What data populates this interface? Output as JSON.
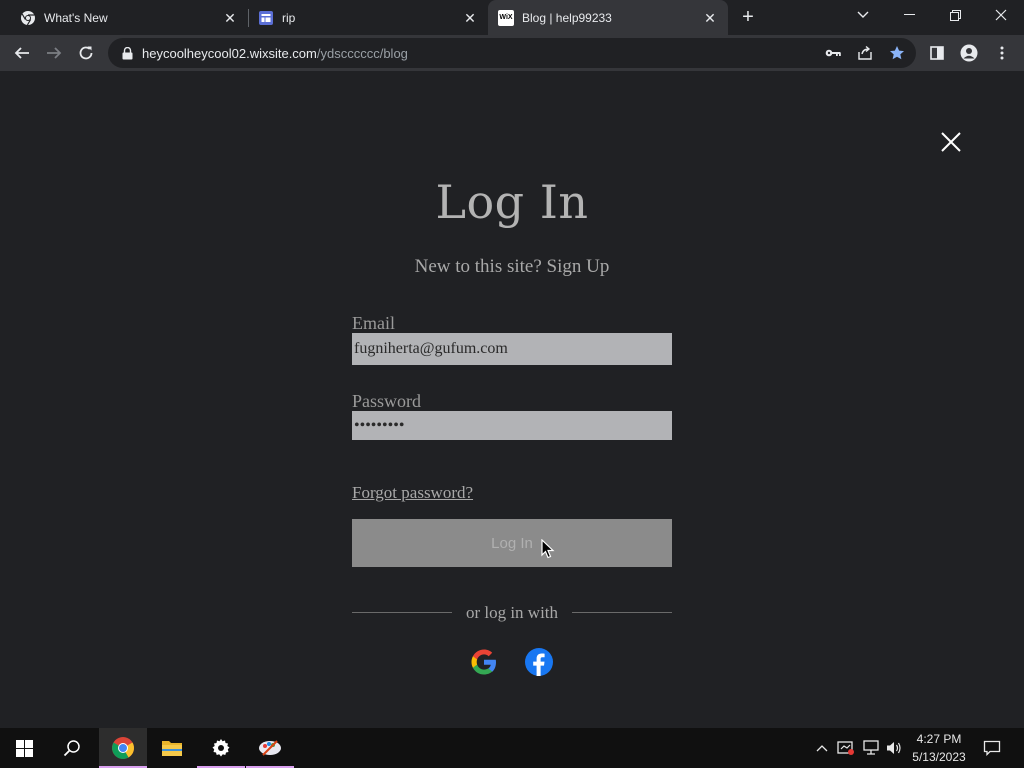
{
  "browser": {
    "tabs": [
      {
        "title": "What's New",
        "active": false
      },
      {
        "title": "rip",
        "active": false
      },
      {
        "title": "Blog | help99233",
        "active": true
      }
    ],
    "url_host": "heycoolheycool02.wixsite.com",
    "url_path": "/ydscccccc/blog",
    "wix_favicon_text": "WiX"
  },
  "login": {
    "title": "Log In",
    "new_to_site": "New to this site?",
    "sign_up": "Sign Up",
    "email_label": "Email",
    "email_value": "fugniherta@gufum.com",
    "password_label": "Password",
    "password_value": "•••••••••",
    "forgot_password": "Forgot password?",
    "login_button": "Log In",
    "or_log_in_with": "or log in with"
  },
  "taskbar": {
    "time": "4:27 PM",
    "date": "5/13/2023"
  },
  "colors": {
    "page_bg": "#202124",
    "input_bg": "#b2b3b6",
    "button_bg": "#8b8b8b",
    "facebook_blue": "#1877f2",
    "bookmark_star": "#8ab4f8"
  }
}
